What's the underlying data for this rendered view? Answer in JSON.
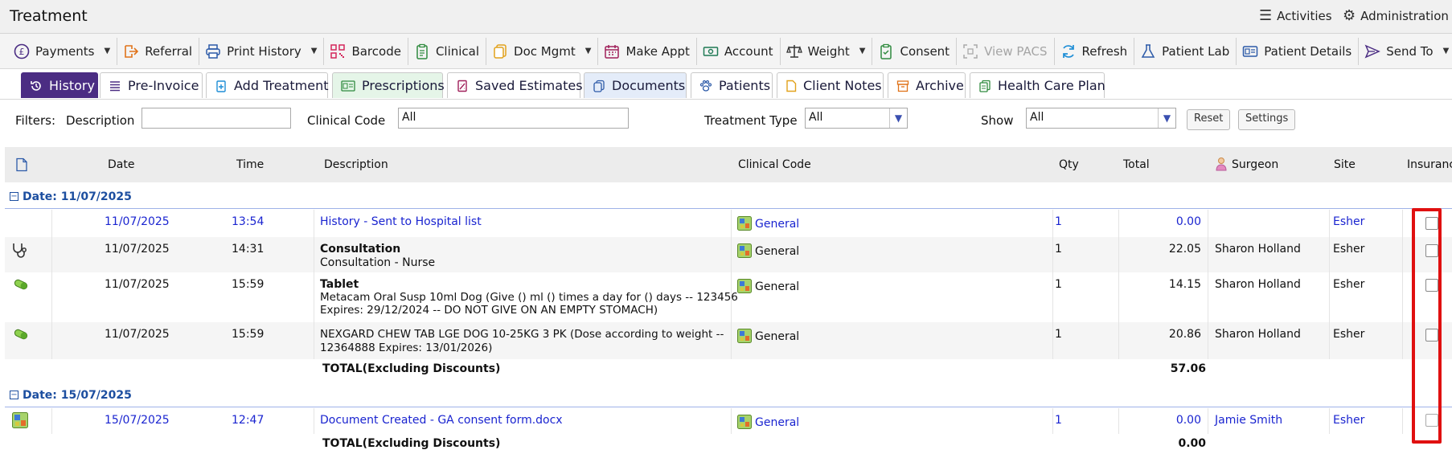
{
  "window": {
    "title": "Treatment"
  },
  "top_right": {
    "activities": "Activities",
    "administration": "Administration"
  },
  "toolbar": {
    "items": [
      {
        "label": "Payments",
        "icon": "pound-circle-icon",
        "dropdown": true
      },
      {
        "label": "Referral",
        "icon": "referral-arrow-icon",
        "dropdown": false
      },
      {
        "label": "Print History",
        "icon": "printer-icon",
        "dropdown": true
      },
      {
        "label": "Barcode",
        "icon": "qr-code-icon",
        "dropdown": false
      },
      {
        "label": "Clinical",
        "icon": "clipboard-icon",
        "dropdown": false
      },
      {
        "label": "Doc Mgmt",
        "icon": "documents-icon",
        "dropdown": true
      },
      {
        "label": "Make Appt",
        "icon": "calendar-icon",
        "dropdown": false
      },
      {
        "label": "Account",
        "icon": "cash-icon",
        "dropdown": false
      },
      {
        "label": "Weight",
        "icon": "scales-icon",
        "dropdown": true
      },
      {
        "label": "Consent",
        "icon": "clipboard-check-icon",
        "dropdown": false
      },
      {
        "label": "View PACS",
        "icon": "pacs-icon",
        "dropdown": false,
        "disabled": true
      },
      {
        "label": "Refresh",
        "icon": "refresh-icon",
        "dropdown": false
      },
      {
        "label": "Patient Lab",
        "icon": "flask-icon",
        "dropdown": false
      },
      {
        "label": "Patient Details",
        "icon": "id-card-icon",
        "dropdown": false
      },
      {
        "label": "Send To",
        "icon": "send-icon",
        "dropdown": true
      }
    ]
  },
  "tabs": [
    {
      "label": "History",
      "icon": "history-icon",
      "active": true
    },
    {
      "label": "Pre-Invoice",
      "icon": "list-icon"
    },
    {
      "label": "Add Treatment",
      "icon": "clipboard-add-icon"
    },
    {
      "label": "Prescriptions",
      "icon": "prescription-icon"
    },
    {
      "label": "Saved Estimates",
      "icon": "estimate-icon"
    },
    {
      "label": "Documents",
      "icon": "documents-icon"
    },
    {
      "label": "Patients",
      "icon": "paw-icon"
    },
    {
      "label": "Client Notes",
      "icon": "note-icon"
    },
    {
      "label": "Archive",
      "icon": "archive-icon"
    },
    {
      "label": "Health Care Plan",
      "icon": "plan-icon"
    }
  ],
  "filters": {
    "label": "Filters:",
    "description_label": "Description",
    "description_value": "",
    "clinical_code_label": "Clinical Code",
    "clinical_code_value": "All",
    "treatment_type_label": "Treatment Type",
    "treatment_type_value": "All",
    "show_label": "Show",
    "show_value": "All",
    "reset": "Reset",
    "settings": "Settings"
  },
  "columns": {
    "date": "Date",
    "time": "Time",
    "description": "Description",
    "clinical_code": "Clinical Code",
    "qty": "Qty",
    "total": "Total",
    "surgeon": "Surgeon",
    "site": "Site",
    "insurance": "Insurance"
  },
  "groups": [
    {
      "label": "Date: 11/07/2025",
      "rows": [
        {
          "date": "11/07/2025",
          "time": "13:54",
          "title": "History - Sent to Hospital list",
          "line1": "",
          "line2": "",
          "code": "General",
          "qty": "1",
          "total": "0.00",
          "surgeon": "",
          "site": "Esher"
        },
        {
          "date": "11/07/2025",
          "time": "14:31",
          "title": "Consultation",
          "line1": "Consultation - Nurse",
          "line2": "",
          "code": "General",
          "qty": "1",
          "total": "22.05",
          "surgeon": "Sharon Holland",
          "site": "Esher"
        },
        {
          "date": "11/07/2025",
          "time": "15:59",
          "title": "Tablet",
          "line1": "Metacam Oral Susp 10ml Dog (Give () ml () times a day for () days -- 123456",
          "line2": "Expires: 29/12/2024 -- DO NOT GIVE ON AN EMPTY STOMACH)",
          "code": "General",
          "qty": "1",
          "total": "14.15",
          "surgeon": "Sharon Holland",
          "site": "Esher"
        },
        {
          "date": "11/07/2025",
          "time": "15:59",
          "title": "",
          "line1": "NEXGARD CHEW TAB LGE DOG 10-25KG 3 PK (Dose according to weight --",
          "line2": "12364888 Expires: 13/01/2026)",
          "code": "General",
          "qty": "1",
          "total": "20.86",
          "surgeon": "Sharon Holland",
          "site": "Esher"
        }
      ],
      "total_label": "TOTAL(Excluding Discounts)",
      "total_value": "57.06"
    },
    {
      "label": "Date: 15/07/2025",
      "rows": [
        {
          "date": "15/07/2025",
          "time": "12:47",
          "title": "Document Created - GA consent form.docx",
          "line1": "",
          "line2": "",
          "code": "General",
          "qty": "1",
          "total": "0.00",
          "surgeon": "Jamie Smith",
          "site": "Esher"
        }
      ],
      "total_label": "TOTAL(Excluding Discounts)",
      "total_value": "0.00"
    }
  ],
  "colors": {
    "accent": "#4b2d83",
    "link": "#1a24d0",
    "group": "#1d4fa0",
    "highlight": "#e01010"
  }
}
